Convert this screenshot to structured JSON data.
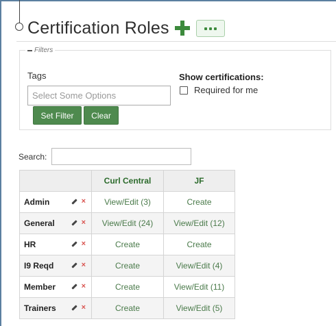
{
  "page": {
    "title": "Certification Roles"
  },
  "filters": {
    "legend": "Filters",
    "tags_label": "Tags",
    "tags_placeholder": "Select Some Options",
    "set_filter_label": "Set Filter",
    "clear_label": "Clear",
    "show_certifications_label": "Show certifications:",
    "required_for_me_label": "Required for me",
    "required_for_me_checked": false
  },
  "search": {
    "label": "Search:",
    "value": ""
  },
  "table": {
    "columns": [
      "",
      "Curl Central",
      "JF"
    ],
    "rows": [
      {
        "role": "Admin",
        "cells": [
          "View/Edit (3)",
          "Create"
        ]
      },
      {
        "role": "General",
        "cells": [
          "View/Edit (24)",
          "View/Edit (12)"
        ]
      },
      {
        "role": "HR",
        "cells": [
          "Create",
          "Create"
        ]
      },
      {
        "role": "I9 Reqd",
        "cells": [
          "Create",
          "View/Edit (4)"
        ]
      },
      {
        "role": "Member",
        "cells": [
          "Create",
          "View/Edit (11)"
        ]
      },
      {
        "role": "Trainers",
        "cells": [
          "Create",
          "View/Edit (5)"
        ]
      }
    ],
    "delete_glyph": "×"
  },
  "icons": {
    "add": "plus-icon",
    "more": "ellipsis-icon",
    "edit": "pencil-icon",
    "delete": "close-icon"
  },
  "colors": {
    "accent_green": "#4e8a4e",
    "header_green": "#2b6a2b",
    "delete_red": "#d9534f",
    "frame_blue": "#5b7fa0"
  }
}
